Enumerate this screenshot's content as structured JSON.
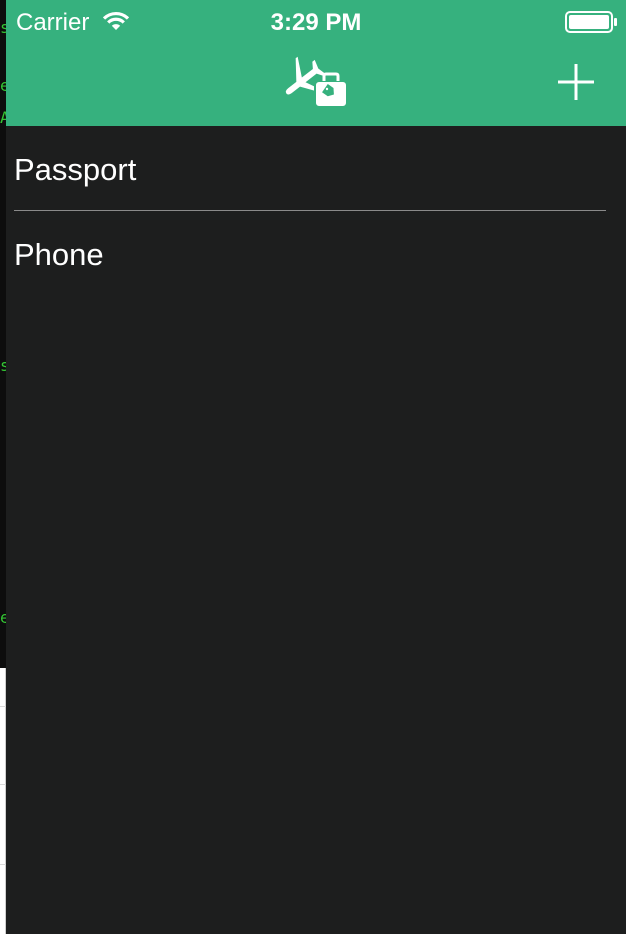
{
  "status_bar": {
    "carrier": "Carrier",
    "time": "3:29 PM",
    "icons": [
      "wifi-icon",
      "battery-icon"
    ]
  },
  "nav": {
    "logo_icon": "plane-suitcase-icon",
    "add_icon": "plus-icon"
  },
  "items": [
    {
      "label": "Passport"
    },
    {
      "label": "Phone"
    }
  ],
  "colors": {
    "nav_background": "#36b17e",
    "list_background": "#1d1e1e",
    "text": "#ffffff",
    "separator": "#8a8a8a"
  }
}
